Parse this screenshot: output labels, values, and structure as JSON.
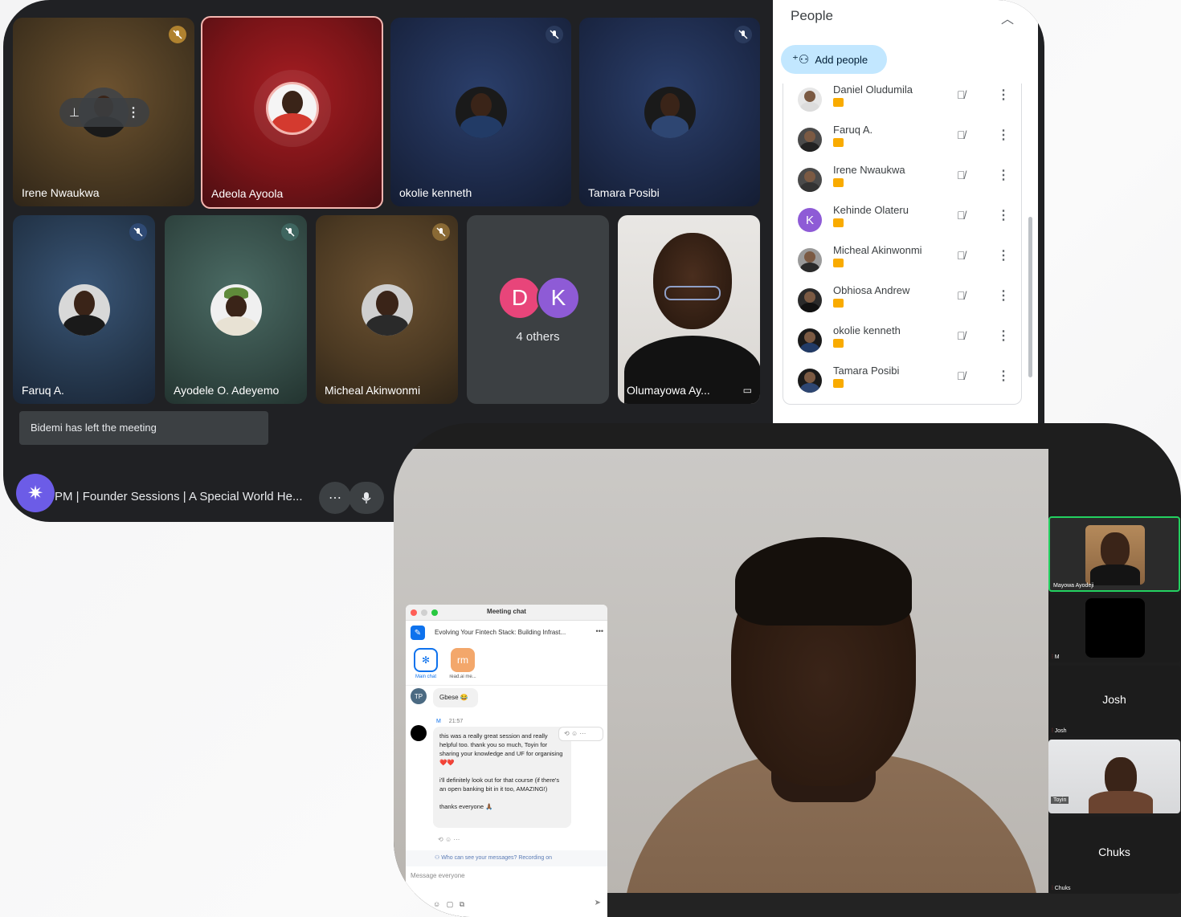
{
  "meet": {
    "tiles": [
      {
        "name": "Irene Nwaukwa",
        "muted": true
      },
      {
        "name": "Adeola Ayoola",
        "muted": false,
        "active_speaker": true
      },
      {
        "name": "okolie kenneth",
        "muted": true
      },
      {
        "name": "Tamara Posibi",
        "muted": true
      },
      {
        "name": "Faruq A.",
        "muted": true
      },
      {
        "name": "Ayodele O. Adeyemo",
        "muted": true
      },
      {
        "name": "Micheal Akinwonmi",
        "muted": true
      },
      {
        "name": "Olumayowa Ay...",
        "muted": false
      }
    ],
    "others": {
      "letters": [
        "D",
        "K"
      ],
      "label": "4 others"
    },
    "toast": "Bidemi has left the meeting",
    "bottom": {
      "info": "PM  |  Founder Sessions | A Special World He...",
      "more_icon": "more-horiz-icon",
      "mic_icon": "mic-icon"
    },
    "people_panel": {
      "title": "People",
      "add_people": "Add people",
      "participants": [
        {
          "name": "Daniel Oludumila",
          "initial": ""
        },
        {
          "name": "Faruq A.",
          "initial": ""
        },
        {
          "name": "Irene Nwaukwa",
          "initial": ""
        },
        {
          "name": "Kehinde Olateru",
          "initial": "K"
        },
        {
          "name": "Micheal Akinwonmi",
          "initial": ""
        },
        {
          "name": "Obhiosa Andrew",
          "initial": ""
        },
        {
          "name": "okolie kenneth",
          "initial": ""
        },
        {
          "name": "Tamara Posibi",
          "initial": ""
        }
      ]
    },
    "colors": {
      "accent": "#c2e7ff",
      "dark": "#202124",
      "speaker_border": "#f3b6b0"
    }
  },
  "zoom": {
    "side_tiles": {
      "mayowa": "Mayowa Ayodeji",
      "m": "M",
      "josh_big": "Josh",
      "josh_small": "Josh",
      "toyin": "Toyin",
      "chuks_big": "Chuks",
      "chuks_small": "Chuks"
    },
    "chat": {
      "window_title": "Meeting chat",
      "topic": "Evolving Your Fintech Stack: Building Infrast...",
      "channels": [
        {
          "label": "Main chat",
          "icon": "TP"
        },
        {
          "label": "read.ai me...",
          "icon": "rm"
        }
      ],
      "messages": [
        {
          "avatar": "TP",
          "text": "Gbese 😂"
        },
        {
          "author": "M",
          "time": "21:57",
          "paragraphs": [
            "this was a really great session and really helpful too. thank you so much, Toyin for sharing your knowledge and UF for organising ❤️❤️",
            "i'll definitely look out for that course (if there's an open banking bit in it too, AMAZING!)",
            "thanks everyone 🙏🏾"
          ]
        }
      ],
      "privacy_note": "Who can see your messages? Recording on",
      "input_placeholder": "Message everyone"
    },
    "colors": {
      "active_tile_border": "#23d160",
      "zoom_blue": "#0e72ed"
    }
  }
}
